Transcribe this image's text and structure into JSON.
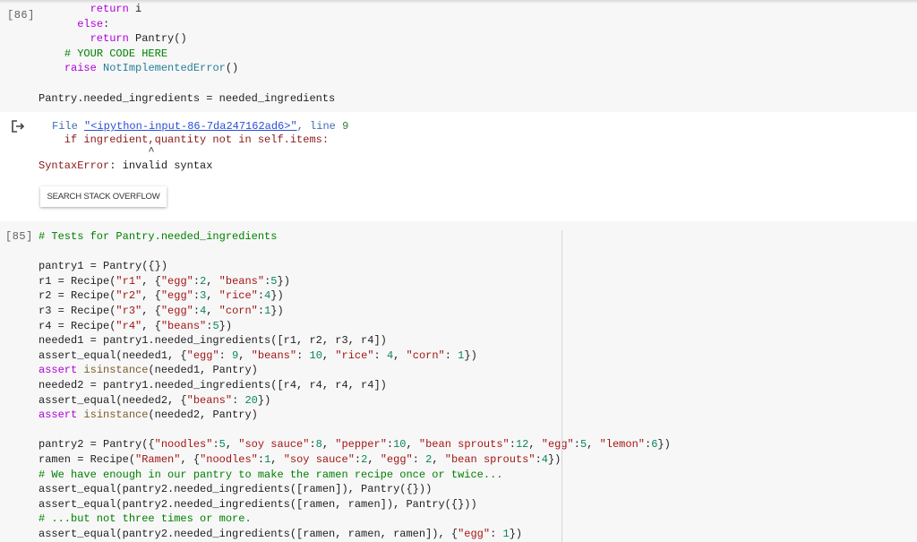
{
  "cell86": {
    "label": "[86]",
    "lines": [
      [
        [
          "        ",
          "p"
        ],
        [
          "return",
          "k"
        ],
        [
          " i",
          "p"
        ]
      ],
      [
        [
          "      ",
          "p"
        ],
        [
          "else",
          "k"
        ],
        [
          ":",
          "p"
        ]
      ],
      [
        [
          "        ",
          "p"
        ],
        [
          "return",
          "k"
        ],
        [
          " Pantry()",
          "p"
        ]
      ],
      [
        [
          "    ",
          "p"
        ],
        [
          "# YOUR CODE HERE",
          "c"
        ]
      ],
      [
        [
          "    ",
          "p"
        ],
        [
          "raise",
          "k"
        ],
        [
          " ",
          "p"
        ],
        [
          "NotImplementedError",
          "e"
        ],
        [
          "()",
          "p"
        ]
      ],
      [],
      [
        [
          "Pantry.needed_ingredients = needed_ingredients",
          "p"
        ]
      ]
    ],
    "output": {
      "file_prefix": "File ",
      "file_link": "\"<ipython-input-86-7da247162ad6>\"",
      "line_sep": ", line ",
      "line_no": "9",
      "code_line": "    if ingredient,quantity not in self.items:",
      "caret": "                 ^",
      "error_name": "SyntaxError",
      "error_msg": ": invalid syntax",
      "button": "SEARCH STACK OVERFLOW"
    }
  },
  "cell85": {
    "label": "[85]",
    "lines": [
      [
        [
          "# Tests for Pantry.needed_ingredients",
          "c"
        ]
      ],
      [],
      [
        [
          "pantry1 = Pantry({})",
          "p"
        ]
      ],
      [
        [
          "r1 = Recipe(",
          "p"
        ],
        [
          "\"r1\"",
          "s"
        ],
        [
          ", {",
          "p"
        ],
        [
          "\"egg\"",
          "s"
        ],
        [
          ":",
          "p"
        ],
        [
          "2",
          "n"
        ],
        [
          ", ",
          "p"
        ],
        [
          "\"beans\"",
          "s"
        ],
        [
          ":",
          "p"
        ],
        [
          "5",
          "n"
        ],
        [
          "})",
          "p"
        ]
      ],
      [
        [
          "r2 = Recipe(",
          "p"
        ],
        [
          "\"r2\"",
          "s"
        ],
        [
          ", {",
          "p"
        ],
        [
          "\"egg\"",
          "s"
        ],
        [
          ":",
          "p"
        ],
        [
          "3",
          "n"
        ],
        [
          ", ",
          "p"
        ],
        [
          "\"rice\"",
          "s"
        ],
        [
          ":",
          "p"
        ],
        [
          "4",
          "n"
        ],
        [
          "})",
          "p"
        ]
      ],
      [
        [
          "r3 = Recipe(",
          "p"
        ],
        [
          "\"r3\"",
          "s"
        ],
        [
          ", {",
          "p"
        ],
        [
          "\"egg\"",
          "s"
        ],
        [
          ":",
          "p"
        ],
        [
          "4",
          "n"
        ],
        [
          ", ",
          "p"
        ],
        [
          "\"corn\"",
          "s"
        ],
        [
          ":",
          "p"
        ],
        [
          "1",
          "n"
        ],
        [
          "})",
          "p"
        ]
      ],
      [
        [
          "r4 = Recipe(",
          "p"
        ],
        [
          "\"r4\"",
          "s"
        ],
        [
          ", {",
          "p"
        ],
        [
          "\"beans\"",
          "s"
        ],
        [
          ":",
          "p"
        ],
        [
          "5",
          "n"
        ],
        [
          "})",
          "p"
        ]
      ],
      [
        [
          "needed1 = pantry1.needed_ingredients([r1, r2, r3, r4])",
          "p"
        ]
      ],
      [
        [
          "assert_equal(needed1, {",
          "p"
        ],
        [
          "\"egg\"",
          "s"
        ],
        [
          ": ",
          "p"
        ],
        [
          "9",
          "n"
        ],
        [
          ", ",
          "p"
        ],
        [
          "\"beans\"",
          "s"
        ],
        [
          ": ",
          "p"
        ],
        [
          "10",
          "n"
        ],
        [
          ", ",
          "p"
        ],
        [
          "\"rice\"",
          "s"
        ],
        [
          ": ",
          "p"
        ],
        [
          "4",
          "n"
        ],
        [
          ", ",
          "p"
        ],
        [
          "\"corn\"",
          "s"
        ],
        [
          ": ",
          "p"
        ],
        [
          "1",
          "n"
        ],
        [
          "})",
          "p"
        ]
      ],
      [
        [
          "assert",
          "k"
        ],
        [
          " ",
          "p"
        ],
        [
          "isinstance",
          "b"
        ],
        [
          "(needed1, Pantry)",
          "p"
        ]
      ],
      [
        [
          "needed2 = pantry1.needed_ingredients([r4, r4, r4, r4])",
          "p"
        ]
      ],
      [
        [
          "assert_equal(needed2, {",
          "p"
        ],
        [
          "\"beans\"",
          "s"
        ],
        [
          ": ",
          "p"
        ],
        [
          "20",
          "n"
        ],
        [
          "})",
          "p"
        ]
      ],
      [
        [
          "assert",
          "k"
        ],
        [
          " ",
          "p"
        ],
        [
          "isinstance",
          "b"
        ],
        [
          "(needed2, Pantry)",
          "p"
        ]
      ],
      [],
      [
        [
          "pantry2 = Pantry({",
          "p"
        ],
        [
          "\"noodles\"",
          "s"
        ],
        [
          ":",
          "p"
        ],
        [
          "5",
          "n"
        ],
        [
          ", ",
          "p"
        ],
        [
          "\"soy sauce\"",
          "s"
        ],
        [
          ":",
          "p"
        ],
        [
          "8",
          "n"
        ],
        [
          ", ",
          "p"
        ],
        [
          "\"pepper\"",
          "s"
        ],
        [
          ":",
          "p"
        ],
        [
          "10",
          "n"
        ],
        [
          ", ",
          "p"
        ],
        [
          "\"bean sprouts\"",
          "s"
        ],
        [
          ":",
          "p"
        ],
        [
          "12",
          "n"
        ],
        [
          ", ",
          "p"
        ],
        [
          "\"egg\"",
          "s"
        ],
        [
          ":",
          "p"
        ],
        [
          "5",
          "n"
        ],
        [
          ", ",
          "p"
        ],
        [
          "\"lemon\"",
          "s"
        ],
        [
          ":",
          "p"
        ],
        [
          "6",
          "n"
        ],
        [
          "})",
          "p"
        ]
      ],
      [
        [
          "ramen = Recipe(",
          "p"
        ],
        [
          "\"Ramen\"",
          "s"
        ],
        [
          ", {",
          "p"
        ],
        [
          "\"noodles\"",
          "s"
        ],
        [
          ":",
          "p"
        ],
        [
          "1",
          "n"
        ],
        [
          ", ",
          "p"
        ],
        [
          "\"soy sauce\"",
          "s"
        ],
        [
          ":",
          "p"
        ],
        [
          "2",
          "n"
        ],
        [
          ", ",
          "p"
        ],
        [
          "\"egg\"",
          "s"
        ],
        [
          ": ",
          "p"
        ],
        [
          "2",
          "n"
        ],
        [
          ", ",
          "p"
        ],
        [
          "\"bean sprouts\"",
          "s"
        ],
        [
          ":",
          "p"
        ],
        [
          "4",
          "n"
        ],
        [
          "})",
          "p"
        ]
      ],
      [
        [
          "# We have enough in our pantry to make the ramen recipe once or twice...",
          "c"
        ]
      ],
      [
        [
          "assert_equal(pantry2.needed_ingredients([ramen]), Pantry({}))",
          "p"
        ]
      ],
      [
        [
          "assert_equal(pantry2.needed_ingredients([ramen, ramen]), Pantry({}))",
          "p"
        ]
      ],
      [
        [
          "# ...but not three times or more.",
          "c"
        ]
      ],
      [
        [
          "assert_equal(pantry2.needed_ingredients([ramen, ramen, ramen]), {",
          "p"
        ],
        [
          "\"egg\"",
          "s"
        ],
        [
          ": ",
          "p"
        ],
        [
          "1",
          "n"
        ],
        [
          "})",
          "p"
        ]
      ]
    ]
  },
  "icons": {
    "output": "output-arrow-icon"
  }
}
